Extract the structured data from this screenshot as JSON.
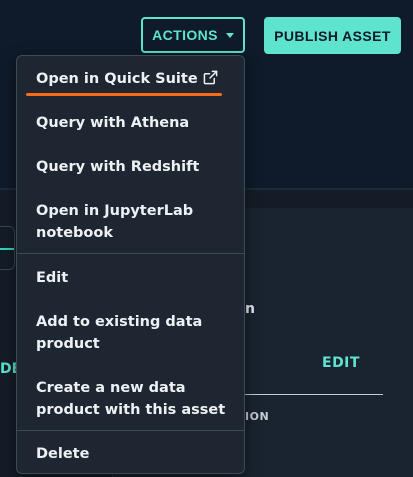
{
  "header": {
    "actions_label": "ACTIONS",
    "publish_label": "PUBLISH ASSET"
  },
  "menu": {
    "items": [
      {
        "label": "Open in Quick Suite"
      },
      {
        "label": "Query with Athena"
      },
      {
        "label": "Query with Redshift"
      },
      {
        "label": "Open in JupyterLab notebook"
      },
      {
        "label": "Edit"
      },
      {
        "label": "Add to existing data product"
      },
      {
        "label": "Create a new data product with this asset"
      },
      {
        "label": "Delete"
      }
    ]
  },
  "background": {
    "fragment_n": "n",
    "fragment_de": "DE",
    "edit_label": "EDIT",
    "fragment_ion": "ION"
  },
  "colors": {
    "accent": "#5de3ce",
    "highlight": "#ff6a1a",
    "menu_bg": "#1d2631",
    "page_bg": "#0f1b2a"
  }
}
